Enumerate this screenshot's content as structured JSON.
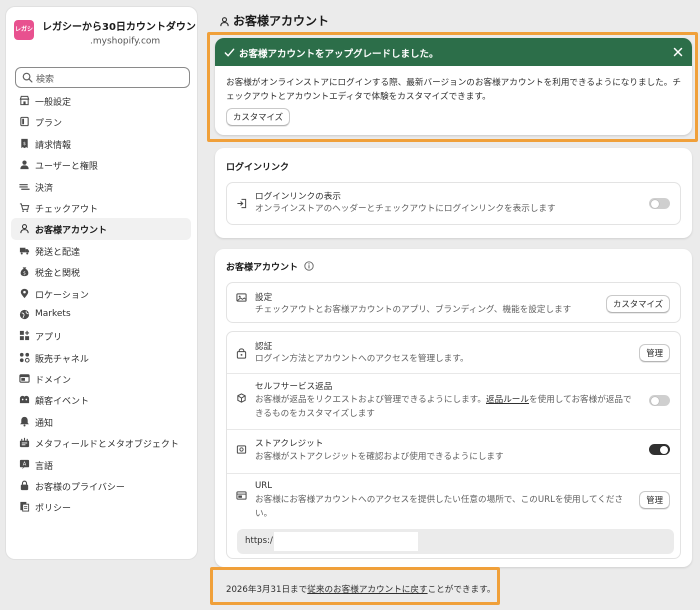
{
  "store": {
    "logo_text": "レガシ",
    "name": "レガシーから30日カウントダウン",
    "domain_suffix": ".myshopify.com",
    "brand_color": "#e8518f"
  },
  "search": {
    "placeholder": "検索"
  },
  "sidebar": {
    "items": [
      {
        "label": "一般設定",
        "icon": "store-icon"
      },
      {
        "label": "プラン",
        "icon": "plan-icon"
      },
      {
        "label": "請求情報",
        "icon": "receipt-icon"
      },
      {
        "label": "ユーザーと権限",
        "icon": "users-icon"
      },
      {
        "label": "決済",
        "icon": "payment-icon"
      },
      {
        "label": "チェックアウト",
        "icon": "cart-icon"
      },
      {
        "label": "お客様アカウント",
        "icon": "person-icon",
        "active": true
      },
      {
        "label": "発送と配達",
        "icon": "truck-icon"
      },
      {
        "label": "税金と関税",
        "icon": "tax-icon"
      },
      {
        "label": "ロケーション",
        "icon": "location-icon"
      },
      {
        "label": "Markets",
        "icon": "globe-icon"
      },
      {
        "label": "アプリ",
        "icon": "apps-icon"
      },
      {
        "label": "販売チャネル",
        "icon": "channels-icon"
      },
      {
        "label": "ドメイン",
        "icon": "domain-icon"
      },
      {
        "label": "顧客イベント",
        "icon": "events-icon"
      },
      {
        "label": "通知",
        "icon": "bell-icon"
      },
      {
        "label": "メタフィールドとメタオブジェクト",
        "icon": "metafields-icon"
      },
      {
        "label": "言語",
        "icon": "language-icon"
      },
      {
        "label": "お客様のプライバシー",
        "icon": "lock-icon"
      },
      {
        "label": "ポリシー",
        "icon": "policy-icon"
      }
    ]
  },
  "page": {
    "title": "お客様アカウント"
  },
  "banner": {
    "title": "お客様アカウントをアップグレードしました。",
    "text": "お客様がオンラインストアにログインする際、最新バージョンのお客様アカウントを利用できるようになりました。チェックアウトとアカウントエディタで体験をカスタマイズできます。",
    "button": "カスタマイズ",
    "color": "#2c6e49"
  },
  "login_link": {
    "title": "ログインリンク",
    "row_title": "ログインリンクの表示",
    "row_desc": "オンラインストアのヘッダーとチェックアウトにログインリンクを表示します",
    "toggle_on": false
  },
  "accounts": {
    "title": "お客様アカウント",
    "settings": {
      "title": "設定",
      "desc": "チェックアウトとお客様アカウントのアプリ、ブランディング、機能を設定します",
      "button": "カスタマイズ"
    },
    "auth": {
      "title": "認証",
      "desc": "ログイン方法とアカウントへのアクセスを管理します。",
      "button": "管理"
    },
    "returns": {
      "title": "セルフサービス返品",
      "desc_before": "お客様が返品をリクエストおよび管理できるようにします。",
      "desc_link": "返品ルール",
      "desc_after": "を使用してお客様が返品できるものをカスタマイズします",
      "toggle_on": false
    },
    "store_credit": {
      "title": "ストアクレジット",
      "desc": "お客様がストアクレジットを確認および使用できるようにします",
      "toggle_on": true
    },
    "url": {
      "title": "URL",
      "desc": "お客様にお客様アカウントへのアクセスを提供したい任意の場所で、このURLを使用してください。",
      "button": "管理",
      "prefix": "https:/"
    }
  },
  "footer": {
    "before": "2026年3月31日まで",
    "link": "従来のお客様アカウントに戻す",
    "after": "ことができます。"
  },
  "highlight_color": "#f0a03a"
}
